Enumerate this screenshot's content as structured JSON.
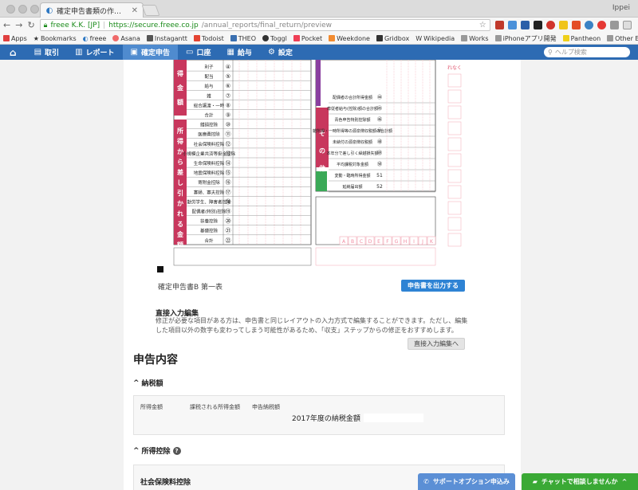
{
  "browser": {
    "tab_title": "確定申告書類の作成 | freee",
    "user": "Ippei",
    "secure_label": "freee K.K. [JP]",
    "url_host": "https://secure.freee.co.jp",
    "url_path": "/annual_reports/final_return/preview"
  },
  "bookmarks": {
    "items": [
      "Apps",
      "Bookmarks",
      "freee",
      "Asana",
      "Instagantt",
      "Todoist",
      "THEO",
      "Toggl",
      "Pocket",
      "Weekdone",
      "Gridbox",
      "Wikipedia",
      "Works",
      "iPhoneアプリ開発",
      "Pantheon"
    ],
    "other": "Other Bookmarks"
  },
  "appnav": {
    "items": [
      "取引",
      "レポート",
      "確定申告",
      "口座",
      "給与",
      "設定"
    ],
    "active_index": 2,
    "search_placeholder": "ヘルプ検索"
  },
  "form": {
    "left_labels": [
      "利子",
      "配当",
      "給与",
      "雑",
      "総合譲渡・一時",
      "合計",
      "雑損控除",
      "医療費控除",
      "社会保険料控除",
      "小規模企業共済等掛金控除",
      "生命保険料控除",
      "地震保険料控除",
      "寄附金控除",
      "寡婦、寡夫控除",
      "勤労学生、障害者控除",
      "配偶者(特別)控除",
      "扶養控除",
      "基礎控除",
      "合計"
    ],
    "left_numbers": [
      "④",
      "⑤",
      "⑥",
      "⑦",
      "⑧",
      "⑨",
      "⑩",
      "⑪",
      "⑫",
      "⑬",
      "⑭",
      "⑮",
      "⑯",
      "⑰",
      "⑱",
      "⑲",
      "⑳",
      "㉑",
      "㉒"
    ],
    "vertical_left_1": "得金額",
    "vertical_left_2": "所得から差し引かれる金額",
    "vertical_right": "その他",
    "right_labels": [
      "配偶者の合計所得金額",
      "専従者給与(控除)額の合計額",
      "青色申告特別控除額",
      "雑所得・一時所得等の源泉徴収税額の合計額",
      "未納付の源泉徴収税額",
      "本年分で差し引く繰越損失額",
      "平均課税対象金額",
      "変動・臨時所得金額",
      "延納届出額"
    ],
    "right_numbers": [
      "㊹",
      "㊺",
      "㊻",
      "㊼",
      "㊽",
      "㊾",
      "㊿",
      "51",
      "52"
    ],
    "letters": [
      "A",
      "B",
      "C",
      "D",
      "E",
      "F",
      "G",
      "H",
      "I",
      "J",
      "K"
    ],
    "red_side_text": "れなく"
  },
  "form_caption": "確定申告書B 第一表",
  "output_button": "申告書を出力する",
  "direct_edit": {
    "title": "直接入力編集",
    "desc": "修正が必要な項目がある方は、申告書と同じレイアウトの入力方式で編集することができます。ただし、編集した項目以外の数字も変わってしまう可能性があるため、「収支」ステップからの修正をおすすめします。",
    "button": "直接入力編集へ"
  },
  "section_title": "申告内容",
  "tax_amount": {
    "heading": "納税額",
    "columns": [
      "所得金額",
      "課税される所得金額",
      "申告納税額"
    ],
    "total_label": "2017年度の納税金額"
  },
  "deductions": {
    "heading": "所得控除",
    "first_item": "社会保険料控除"
  },
  "support_button": "サポートオプション申込み",
  "chat_button": "チャットで相談しませんか"
}
